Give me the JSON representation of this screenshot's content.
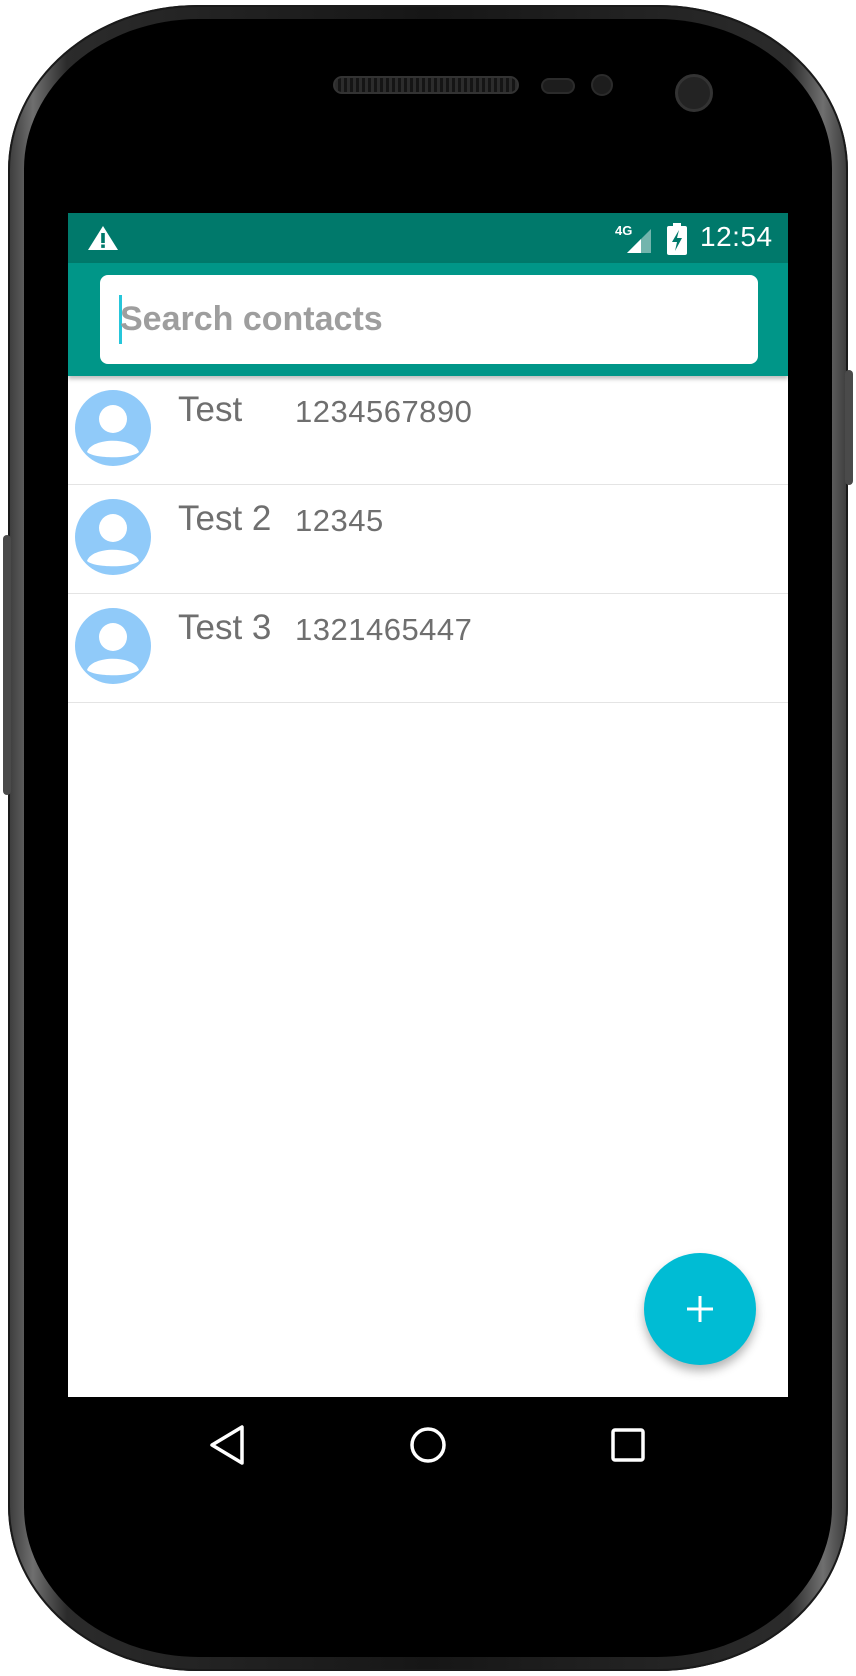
{
  "status_bar": {
    "network_label": "4G",
    "time": "12:54",
    "icons": [
      "warning-icon",
      "signal-icon",
      "battery-charging-icon"
    ]
  },
  "search": {
    "placeholder": "Search contacts",
    "value": ""
  },
  "contacts": [
    {
      "name": "Test",
      "phone": "1234567890"
    },
    {
      "name": "Test 2",
      "phone": "12345"
    },
    {
      "name": "Test 3",
      "phone": "1321465447"
    }
  ],
  "fab": {
    "icon": "plus-icon",
    "label": "+"
  },
  "nav": {
    "icons": [
      "back-icon",
      "home-icon",
      "recents-icon"
    ]
  },
  "colors": {
    "status_bar": "#00796b",
    "toolbar": "#009688",
    "accent": "#00bcd4",
    "avatar": "#90caf9",
    "text": "#6f6f6f"
  }
}
